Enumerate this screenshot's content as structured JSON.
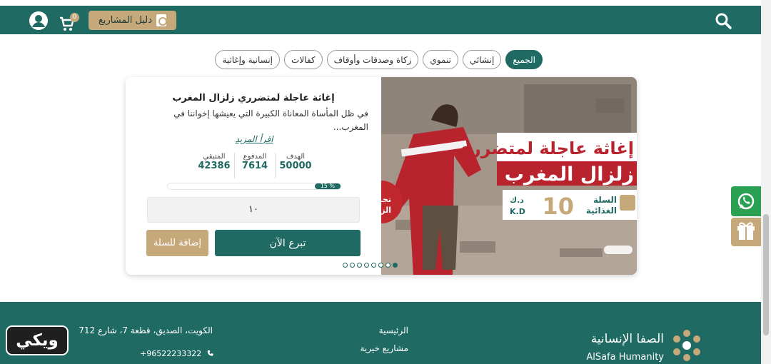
{
  "header": {
    "guide_label": "دليل المشاريع",
    "cart_count": "0",
    "icons": [
      "search-icon",
      "user-icon",
      "cart-icon",
      "pdf-icon"
    ],
    "color": "#1f6b63",
    "accent": "#c5a97a"
  },
  "filters": [
    {
      "label": "الجميع",
      "active": true
    },
    {
      "label": "إنشائي",
      "active": false
    },
    {
      "label": "تنموي",
      "active": false
    },
    {
      "label": "زكاة وصدقات وأوقاف",
      "active": false
    },
    {
      "label": "كفالات",
      "active": false
    },
    {
      "label": "إنسانية وإغاثية",
      "active": false
    }
  ],
  "project": {
    "title": "إغاثة عاجلة لمتضرري زلزال المغرب",
    "description": "في ظل المأساة المعاناة الكبيرة التي يعيشها إخواننا في المغرب...",
    "read_more": "اقرأ المزيد",
    "stats": {
      "goal_label": "الهدف",
      "goal_value": "50000",
      "paid_label": "المدفوع",
      "paid_value": "7614",
      "remaining_label": "المتبقي",
      "remaining_value": "42386"
    },
    "progress_label": "15 %",
    "progress_percent": 15,
    "quantity_value": "١٠",
    "donate_label": "تبرع الآن",
    "add_to_cart_label": "إضافة للسلة",
    "slider_dots": 8,
    "slider_active": 7,
    "image": {
      "headline_line1": "إغاثة عاجلة لمتضرري",
      "headline_line2": "زلزال المغرب",
      "basket_label_1": "السلة",
      "basket_label_2": "الغذائية",
      "price": "10",
      "currency_ar": "د.ك",
      "currency_en": "K.D",
      "stamp_text_1": "تجـ",
      "stamp_text_2": "الزكـ"
    }
  },
  "side": {
    "icons": [
      "whatsapp-icon",
      "gift-icon"
    ]
  },
  "footer": {
    "address": "الكويت، الصديق، قطعة 7، شارع 712",
    "phone": "+96522233322",
    "link_home": "الرئيسية",
    "link_projects": "مشاريع خيرية",
    "logo_ar": "الصفا الإنسانية",
    "logo_en": "AlSafa Humanity"
  },
  "watermark": "ويكي"
}
